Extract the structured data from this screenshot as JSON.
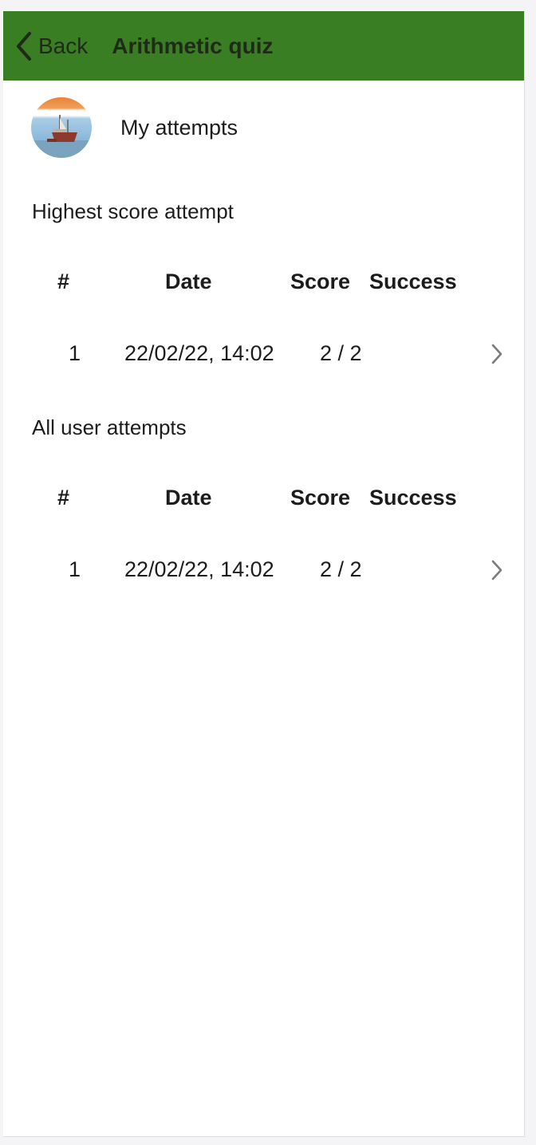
{
  "header": {
    "back_label": "Back",
    "title": "Arithmetic quiz",
    "bg_color": "#3a7e23"
  },
  "profile": {
    "label": "My attempts",
    "avatar_icon": "ship-photo-avatar"
  },
  "highest": {
    "title": "Highest score attempt",
    "columns": [
      "#",
      "Date",
      "Score",
      "Success"
    ],
    "rows": [
      {
        "num": "1",
        "date": "22/02/22, 14:02",
        "score": "2 / 2",
        "success": ""
      }
    ]
  },
  "all": {
    "title": "All user attempts",
    "columns": [
      "#",
      "Date",
      "Score",
      "Success"
    ],
    "rows": [
      {
        "num": "1",
        "date": "22/02/22, 14:02",
        "score": "2 / 2",
        "success": ""
      }
    ]
  }
}
